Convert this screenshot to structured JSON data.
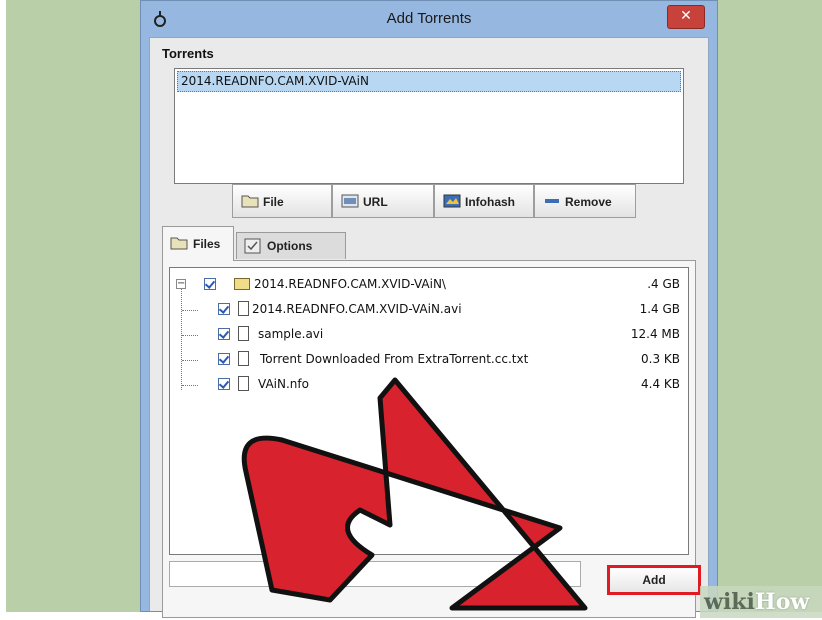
{
  "window": {
    "title": "Add Torrents",
    "close_label": "✕"
  },
  "torrents": {
    "label": "Torrents",
    "items": [
      "2014.READNFO.CAM.XVID-VAiN"
    ]
  },
  "toolbar": {
    "file_label": "File",
    "url_label": "URL",
    "infohash_label": "Infohash",
    "remove_label": "Remove"
  },
  "tabs": {
    "files_label": "Files",
    "options_label": "Options"
  },
  "files": {
    "root": {
      "name": "2014.READNFO.CAM.XVID-VAiN\\",
      "size": ".4 GB"
    },
    "children": [
      {
        "name": "2014.READNFO.CAM.XVID-VAiN.avi",
        "size": "1.4 GB"
      },
      {
        "name": "sample.avi",
        "size": "12.4 MB"
      },
      {
        "name": "Torrent Downloaded From ExtraTorrent.cc.txt",
        "size": "0.3 KB"
      },
      {
        "name": "VAiN.nfo",
        "size": "4.4 KB"
      }
    ]
  },
  "actions": {
    "add_label": "Add"
  },
  "watermark": {
    "part1": "wiki",
    "part2": "How"
  },
  "colors": {
    "arrow": "#d8232f",
    "highlight": "#e01b24",
    "selection": "#b8d7f2"
  }
}
